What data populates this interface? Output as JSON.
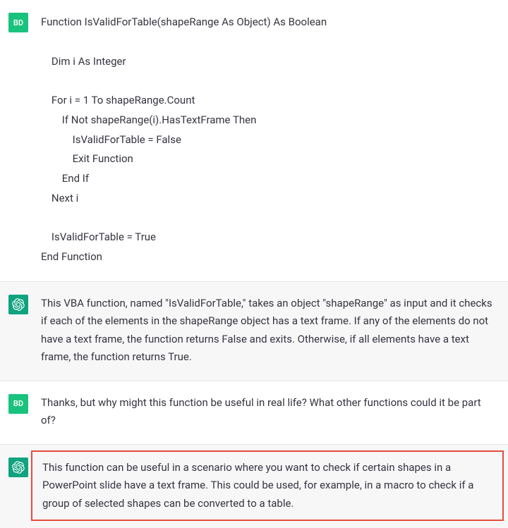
{
  "messages": [
    {
      "role": "user",
      "avatar": "BD",
      "code": "Function IsValidForTable(shapeRange As Object) As Boolean\n\n    Dim i As Integer\n\n    For i = 1 To shapeRange.Count\n        If Not shapeRange(i).HasTextFrame Then\n            IsValidForTable = False\n            Exit Function\n        End If\n    Next i\n\n    IsValidForTable = True\nEnd Function"
    },
    {
      "role": "assistant",
      "avatar": "GPT",
      "text": "This VBA function, named \"IsValidForTable,\" takes an object \"shapeRange\" as input and it checks if each of the elements in the shapeRange object has a text frame. If any of the elements do not have a text frame, the function returns False and exits. Otherwise, if all elements have a text frame, the function returns True."
    },
    {
      "role": "user",
      "avatar": "BD",
      "text": "Thanks, but why might this function be useful in real life? What other functions could it be part of?"
    },
    {
      "role": "assistant",
      "avatar": "GPT",
      "highlighted": true,
      "text": "This function can be useful in a scenario where you want to check if certain shapes in a PowerPoint slide have a text frame. This could be used, for example, in a macro to check if a group of selected shapes can be converted to a table."
    }
  ]
}
